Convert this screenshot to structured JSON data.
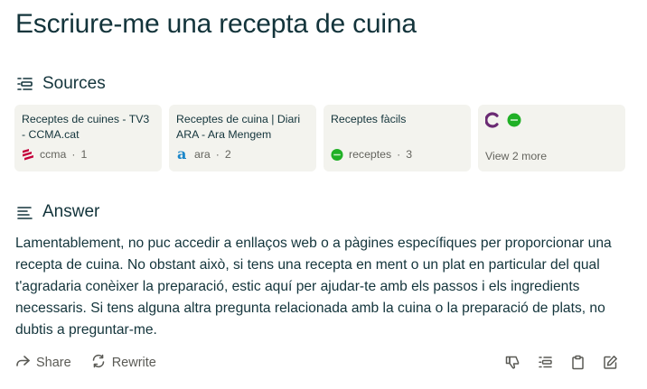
{
  "page": {
    "title": "Escriure-me una recepta de cuina"
  },
  "sources_section": {
    "label": "Sources"
  },
  "sources": [
    {
      "title": "Receptes de cuines - TV3 - CCMA.cat",
      "site": "ccma",
      "index": "1",
      "favicon_color": "#c4003b"
    },
    {
      "title": "Receptes de cuina | Diari ARA - Ara Mengem",
      "site": "ara",
      "index": "2",
      "favicon_color": "#1a86c9"
    },
    {
      "title": "Receptes fàcils",
      "site": "receptes",
      "index": "3",
      "favicon_color": "#20b026"
    }
  ],
  "more_sources": {
    "label": "View 2 more",
    "favicon_colors": [
      "#6a2a73",
      "#20b026"
    ]
  },
  "answer_section": {
    "label": "Answer"
  },
  "answer": {
    "text": "Lamentablement, no puc accedir a enllaços web o a pàgines específiques per proporcionar una recepta de cuina. No obstant això, si tens una recepta en ment o un plat en particular del qual t'agradaria conèixer la preparació, estic aquí per ajudar-te amb els passos i els ingredients necessaris. Si tens alguna altra pregunta relacionada amb la cuina o la preparació de plats, no dubtis a preguntar-me."
  },
  "actions": {
    "share_label": "Share",
    "rewrite_label": "Rewrite"
  },
  "separator": "·",
  "icons": [
    "sources-icon",
    "answer-icon",
    "share-icon",
    "rewrite-icon",
    "thumbs-down-icon",
    "sources-list-icon",
    "clipboard-icon",
    "edit-icon"
  ]
}
